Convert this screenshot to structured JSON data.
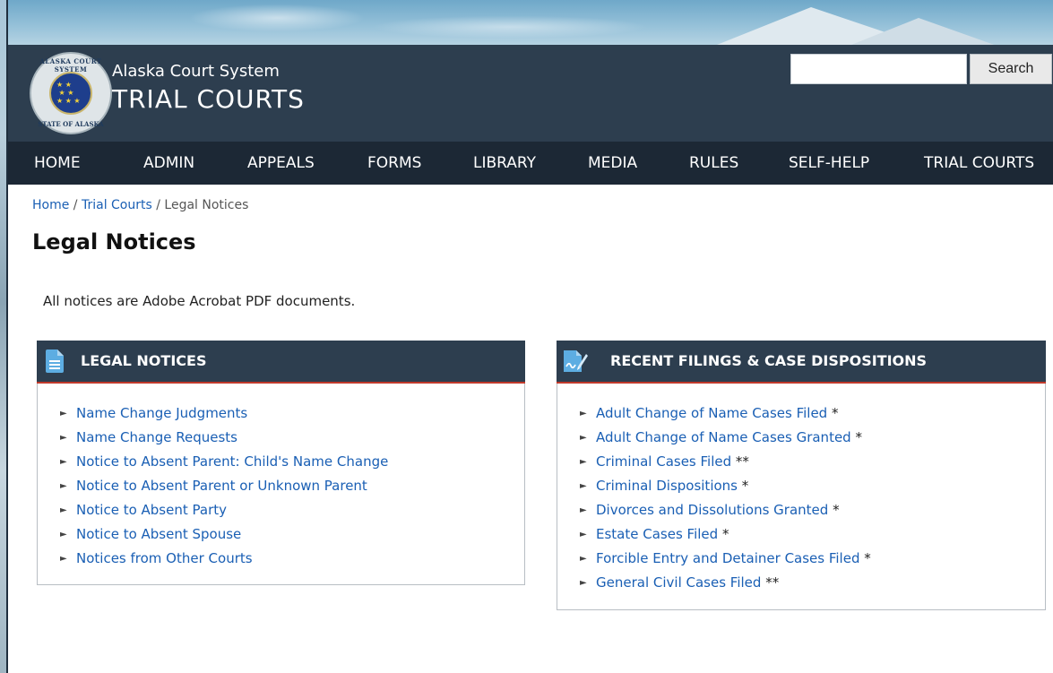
{
  "header": {
    "seal_top_text": "ALASKA COURT SYSTEM",
    "seal_bottom_text": "STATE OF ALASKA",
    "brand_subtitle": "Alaska Court System",
    "brand_title": "TRIAL COURTS"
  },
  "search": {
    "value": "",
    "placeholder": "",
    "button_label": "Search"
  },
  "nav": {
    "items": [
      "HOME",
      "ADMIN",
      "APPEALS",
      "FORMS",
      "LIBRARY",
      "MEDIA",
      "RULES",
      "SELF-HELP",
      "TRIAL COURTS"
    ]
  },
  "breadcrumb": {
    "home": "Home",
    "sep": " / ",
    "trial_courts": "Trial Courts",
    "current": "Legal Notices"
  },
  "page": {
    "title": "Legal Notices",
    "intro": "All notices are Adobe Acrobat PDF documents."
  },
  "legal_notices": {
    "heading": "LEGAL NOTICES",
    "icon": "document-icon",
    "items": [
      {
        "label": "Name Change Judgments",
        "suffix": ""
      },
      {
        "label": "Name Change Requests",
        "suffix": ""
      },
      {
        "label": "Notice to Absent Parent: Child's Name Change",
        "suffix": ""
      },
      {
        "label": "Notice to Absent Parent or Unknown Parent",
        "suffix": ""
      },
      {
        "label": "Notice to Absent Party",
        "suffix": ""
      },
      {
        "label": "Notice to Absent Spouse",
        "suffix": ""
      },
      {
        "label": "Notices from Other Courts",
        "suffix": ""
      }
    ]
  },
  "recent_filings": {
    "heading": "RECENT FILINGS & CASE DISPOSITIONS",
    "icon": "signed-document-icon",
    "items": [
      {
        "label": "Adult Change of Name Cases Filed",
        "suffix": " *"
      },
      {
        "label": "Adult Change of Name Cases Granted",
        "suffix": " *"
      },
      {
        "label": "Criminal Cases Filed",
        "suffix": " **"
      },
      {
        "label": "Criminal Dispositions",
        "suffix": " *"
      },
      {
        "label": "Divorces and Dissolutions Granted",
        "suffix": " *"
      },
      {
        "label": "Estate Cases Filed",
        "suffix": " *"
      },
      {
        "label": "Forcible Entry and Detainer Cases Filed",
        "suffix": " *"
      },
      {
        "label": "General Civil Cases Filed",
        "suffix": " **"
      }
    ]
  },
  "colors": {
    "header_bg": "#2d3e4f",
    "nav_bg": "#1c2835",
    "link": "#1a5fb4",
    "panel_accent": "#c0392b"
  }
}
